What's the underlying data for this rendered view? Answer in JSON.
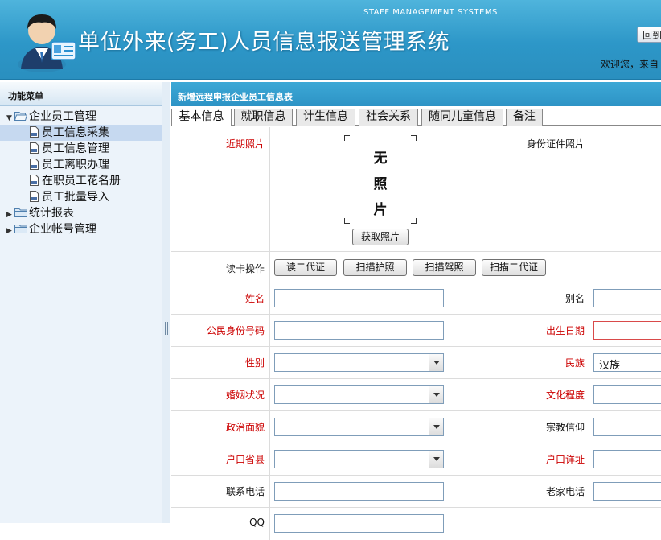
{
  "header": {
    "title": "单位外来(务工)人员信息报送管理系统",
    "subtitle": "STAFF MANAGEMENT SYSTEMS",
    "home_button": "回到首页",
    "welcome": "欢迎您，来自"
  },
  "sidebar": {
    "title": "功能菜单",
    "tree": [
      {
        "label": "企业员工管理",
        "expanded": true,
        "items": [
          {
            "label": "员工信息采集",
            "selected": true
          },
          {
            "label": "员工信息管理"
          },
          {
            "label": "员工离职办理"
          },
          {
            "label": "在职员工花名册"
          },
          {
            "label": "员工批量导入"
          }
        ]
      },
      {
        "label": "统计报表",
        "expanded": false
      },
      {
        "label": "企业帐号管理",
        "expanded": false
      }
    ]
  },
  "main": {
    "panel_title": "新增远程申报企业员工信息表",
    "tabs": [
      {
        "label": "基本信息",
        "active": true
      },
      {
        "label": "就职信息"
      },
      {
        "label": "计生信息"
      },
      {
        "label": "社会关系"
      },
      {
        "label": "随同儿童信息"
      },
      {
        "label": "备注"
      }
    ],
    "photo": {
      "label": "近期照片",
      "no_photo": [
        "无",
        "照",
        "片"
      ],
      "button": "获取照片",
      "id_photo_label": "身份证件照片"
    },
    "card_reader": {
      "label": "读卡操作",
      "buttons": [
        "读二代证",
        "扫描护照",
        "扫描驾照",
        "扫描二代证"
      ]
    },
    "fields": {
      "name": {
        "label": "姓名",
        "value": ""
      },
      "alias": {
        "label": "别名",
        "value": ""
      },
      "id_number": {
        "label": "公民身份号码",
        "value": ""
      },
      "birth_date": {
        "label": "出生日期",
        "value": ""
      },
      "gender": {
        "label": "性别",
        "value": ""
      },
      "ethnicity": {
        "label": "民族",
        "value": "汉族"
      },
      "marital": {
        "label": "婚姻状况",
        "value": ""
      },
      "education": {
        "label": "文化程度",
        "value": ""
      },
      "political": {
        "label": "政治面貌",
        "value": ""
      },
      "religion": {
        "label": "宗教信仰",
        "value": ""
      },
      "hukou_county": {
        "label": "户口省县",
        "value": ""
      },
      "hukou_detail": {
        "label": "户口详址",
        "value": ""
      },
      "phone": {
        "label": "联系电话",
        "value": ""
      },
      "home_phone": {
        "label": "老家电话",
        "value": ""
      },
      "qq": {
        "label": "QQ",
        "value": ""
      }
    }
  },
  "colors": {
    "header_blue": "#2d97c8",
    "required_label": "#cc0000",
    "sidebar_bg": "#ecf3fa",
    "selected_item": "#c6d9f0"
  }
}
